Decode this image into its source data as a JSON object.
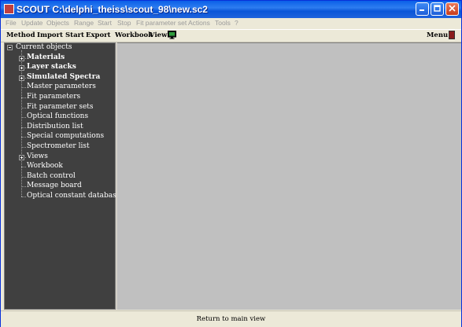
{
  "window": {
    "title": "SCOUT C:\\delphi_theiss\\scout_98\\new.sc2"
  },
  "menubar": [
    "File",
    "Update",
    "Objects",
    "Range",
    "Start",
    "Stop",
    "Fit parameter set",
    "Actions",
    "Tools",
    "?"
  ],
  "toolbar": {
    "items": [
      "Method",
      "Import",
      "Start",
      "Export",
      "Workbook",
      "View"
    ],
    "right_label": "Menu"
  },
  "tree": {
    "root": "Current objects",
    "items": [
      {
        "label": "Materials",
        "bold": true,
        "expandable": true
      },
      {
        "label": "Layer stacks",
        "bold": true,
        "expandable": true
      },
      {
        "label": "Simulated Spectra",
        "bold": true,
        "expandable": true
      },
      {
        "label": "Master parameters",
        "bold": false,
        "expandable": false
      },
      {
        "label": "Fit parameters",
        "bold": false,
        "expandable": false
      },
      {
        "label": "Fit parameter sets",
        "bold": false,
        "expandable": false
      },
      {
        "label": "Optical functions",
        "bold": false,
        "expandable": false
      },
      {
        "label": "Distribution list",
        "bold": false,
        "expandable": false
      },
      {
        "label": "Special computations",
        "bold": false,
        "expandable": false
      },
      {
        "label": "Spectrometer list",
        "bold": false,
        "expandable": false
      },
      {
        "label": "Views",
        "bold": false,
        "expandable": true
      },
      {
        "label": "Workbook",
        "bold": false,
        "expandable": false
      },
      {
        "label": "Batch control",
        "bold": false,
        "expandable": false
      },
      {
        "label": "Message board",
        "bold": false,
        "expandable": false
      },
      {
        "label": "Optical constant database",
        "bold": false,
        "expandable": false
      }
    ]
  },
  "statusbar": {
    "label": "Return to main view"
  }
}
